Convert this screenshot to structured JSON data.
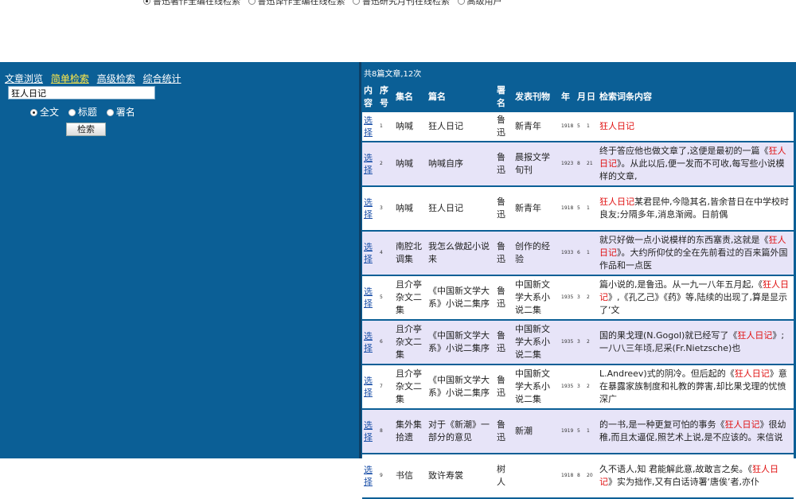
{
  "top_options": [
    {
      "label": "鲁迅著作全编在线检索",
      "checked": true
    },
    {
      "label": "鲁迅译作全编在线检索",
      "checked": false
    },
    {
      "label": "鲁迅研究月刊在线检索",
      "checked": false
    },
    {
      "label": "高级用户",
      "checked": false
    }
  ],
  "nav": {
    "browse": "文章浏览",
    "simple": "简单检索",
    "advanced": "高级检索",
    "stats": "综合统计"
  },
  "search": {
    "query": "狂人日记",
    "button": "检索",
    "scope": {
      "full": "全文",
      "title": "标题",
      "signature": "署名"
    }
  },
  "summary": "共8篇文章,12次",
  "columns": {
    "select": "内容",
    "no": "序号",
    "collection": "集名",
    "title": "篇名",
    "signature": "署名",
    "journal": "发表刊物",
    "year": "年",
    "month": "月",
    "day": "日",
    "context": "检索词条内容"
  },
  "select_label": "选择",
  "rows": [
    {
      "no": "1",
      "collection": "呐喊",
      "title": "狂人日记",
      "signature": "鲁迅",
      "journal": "新青年",
      "year": "1918",
      "month": "5",
      "day": "1",
      "pre": "",
      "hit": "狂人日记",
      "post": ""
    },
    {
      "no": "2",
      "collection": "呐喊",
      "title": "呐喊自序",
      "signature": "鲁迅",
      "journal": "晨报文学旬刊",
      "year": "1923",
      "month": "8",
      "day": "21",
      "pre": "终于答应他也做文章了,这便是最初的一篇《",
      "hit": "狂人日记",
      "post": "》。从此以后,便一发而不可收,每写些小说模样的文章,"
    },
    {
      "no": "3",
      "collection": "呐喊",
      "title": "狂人日记",
      "signature": "鲁迅",
      "journal": "新青年",
      "year": "1918",
      "month": "5",
      "day": "1",
      "pre": "",
      "hit": "狂人日记",
      "post": "某君昆仲,今隐其名,皆余昔日在中学校时良友;分隔多年,消息渐阙。日前偶"
    },
    {
      "no": "4",
      "collection": "南腔北调集",
      "title": "我怎么做起小说来",
      "signature": "鲁迅",
      "journal": "创作的经验",
      "year": "1933",
      "month": "6",
      "day": "1",
      "pre": "就只好做一点小说模样的东西塞责,这就是《",
      "hit": "狂人日记",
      "post": "》。大约所仰仗的全在先前看过的百来篇外国作品和一点医"
    },
    {
      "no": "5",
      "collection": "且介亭杂文二集",
      "title": "《中国新文学大系》小说二集序",
      "signature": "鲁迅",
      "journal": "中国新文学大系小说二集",
      "year": "1935",
      "month": "3",
      "day": "2",
      "pre": "篇小说的,是鲁迅。从一九一八年五月起,《",
      "hit": "狂人日记",
      "post": "》,《孔乙己》《药》等,陆续的出现了,算是显示了‘文"
    },
    {
      "no": "6",
      "collection": "且介亭杂文二集",
      "title": "《中国新文学大系》小说二集序",
      "signature": "鲁迅",
      "journal": "中国新文学大系小说二集",
      "year": "1935",
      "month": "3",
      "day": "2",
      "pre": "国的果戈理(N.Gogol)就已经写了《",
      "hit": "狂人日记",
      "post": "》;一八八三年顷,尼采(Fr.Nietzsche)也"
    },
    {
      "no": "7",
      "collection": "且介亭杂文二集",
      "title": "《中国新文学大系》小说二集序",
      "signature": "鲁迅",
      "journal": "中国新文学大系小说二集",
      "year": "1935",
      "month": "3",
      "day": "2",
      "pre": "L.Andreev)式的阴冷。但后起的《",
      "hit": "狂人日记",
      "post": "》意在暴露家族制度和礼教的弊害,却比果戈理的忧愤深广"
    },
    {
      "no": "8",
      "collection": "集外集拾遗",
      "title": "对于《新潮》一部分的意见",
      "signature": "鲁迅",
      "journal": "新潮",
      "year": "1919",
      "month": "5",
      "day": "1",
      "pre": "的一书,是一种更复可怕的事务《",
      "hit": "狂人日记",
      "post": "》很幼稚,而且太逼促,照艺术上说,是不应该的。来信说"
    },
    {
      "no": "9",
      "collection": "书信",
      "title": "致许寿裳",
      "signature": "树人",
      "journal": "",
      "year": "1918",
      "month": "8",
      "day": "20",
      "pre": "久不语人,知 君能解此意,故敢言之矣。《",
      "hit": "狂人日记",
      "post": "》实为拙作,又有白话诗署‘唐俟’者,亦仆"
    }
  ]
}
